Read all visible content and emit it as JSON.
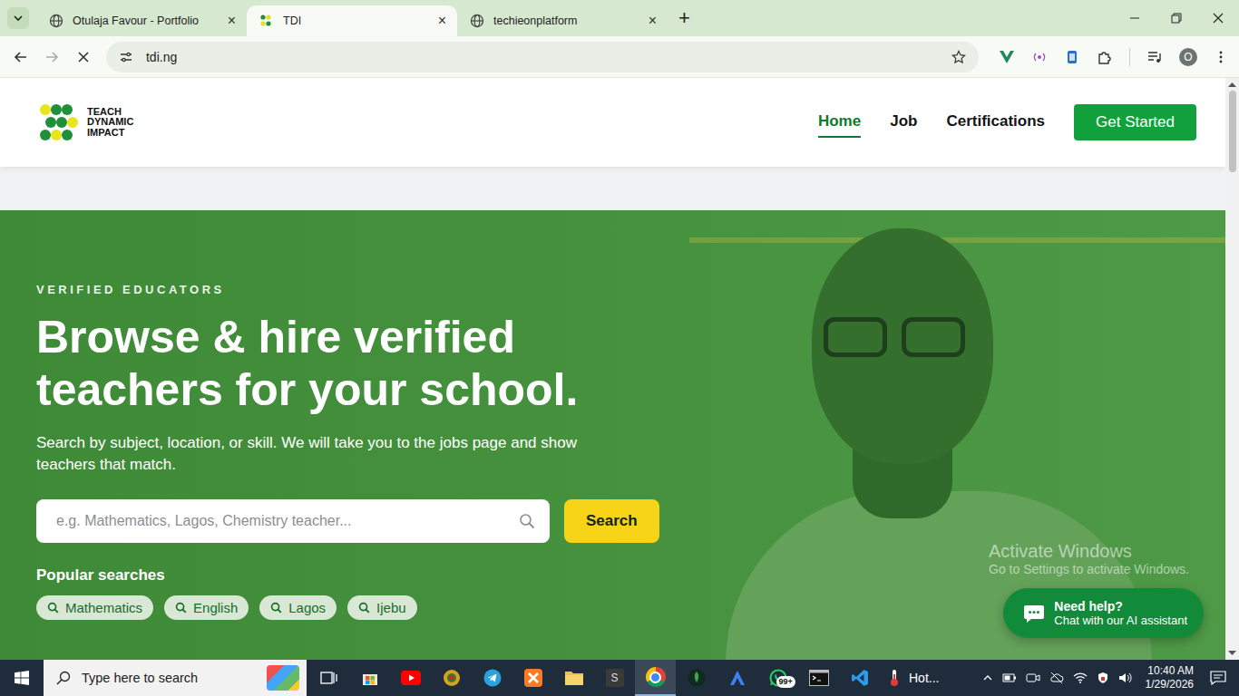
{
  "browser": {
    "tabs": [
      {
        "label": "Otulaja Favour - Portfolio",
        "selected": false
      },
      {
        "label": "TDI",
        "selected": true
      },
      {
        "label": "techieonplatform",
        "selected": false
      }
    ],
    "close": "×",
    "new_tab": "+",
    "address": "tdi.ng",
    "profile": "O"
  },
  "site": {
    "logo": [
      "TEACH",
      "DYNAMIC",
      "IMPACT"
    ],
    "nav": [
      {
        "label": "Home",
        "selected": true
      },
      {
        "label": "Job",
        "selected": false
      },
      {
        "label": "Certifications",
        "selected": false
      }
    ],
    "cta": "Get Started"
  },
  "hero": {
    "eyebrow": "VERIFIED EDUCATORS",
    "title": "Browse & hire verified teachers for your school.",
    "subtitle": "Search by subject, location, or skill. We will take you to the jobs page and show teachers that match.",
    "search": {
      "placeholder": "e.g. Mathematics, Lagos, Chemistry teacher...",
      "button": "Search"
    },
    "popular_title": "Popular searches",
    "popular": [
      "Mathematics",
      "English",
      "Lagos",
      "Ijebu"
    ]
  },
  "chat": {
    "title": "Need help?",
    "subtitle": "Chat with our AI assistant"
  },
  "watermark": {
    "title": "Activate Windows",
    "subtitle": "Go to Settings to activate Windows."
  },
  "taskbar": {
    "search": "Type here to search",
    "apps": [
      {
        "kind": "taskview",
        "selected": false
      },
      {
        "kind": "store",
        "selected": false
      },
      {
        "kind": "youtube",
        "selected": false
      },
      {
        "kind": "chromium",
        "selected": false
      },
      {
        "kind": "telegram",
        "selected": false
      },
      {
        "kind": "xampp",
        "selected": false
      },
      {
        "kind": "folder",
        "selected": false
      },
      {
        "kind": "letter",
        "label": "S",
        "selected": false
      },
      {
        "kind": "chrome",
        "selected": true
      },
      {
        "kind": "leaf",
        "selected": false
      },
      {
        "kind": "triangle",
        "selected": false
      },
      {
        "kind": "whatsapp",
        "badge": "99+",
        "selected": false
      },
      {
        "kind": "terminal",
        "selected": false
      },
      {
        "kind": "vscode",
        "selected": false
      }
    ],
    "weather": "Hot...",
    "time": "10:40 AM",
    "date": "1/29/2026"
  }
}
